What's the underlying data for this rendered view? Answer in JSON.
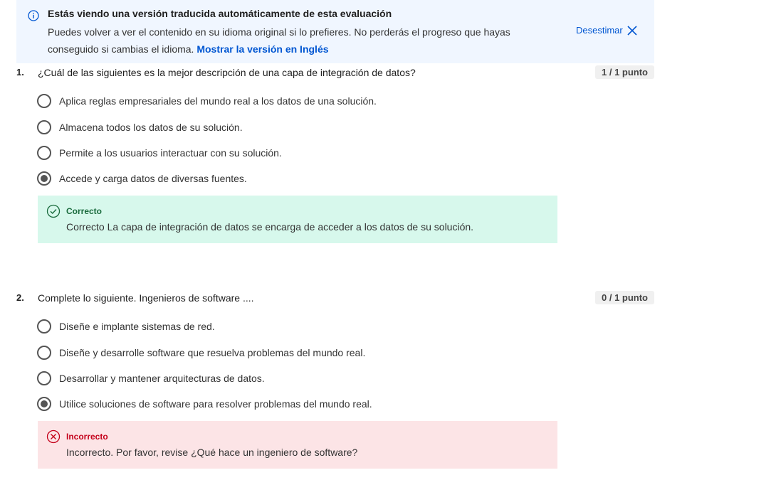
{
  "banner": {
    "icon": "info-icon",
    "title": "Estás viendo una versión traducida automáticamente de esta evaluación",
    "text": "Puedes volver a ver el contenido en su idioma original si lo prefieres. No perderás el progreso que hayas conseguido si cambias el idioma.",
    "link": "Mostrar la versión en Inglés",
    "dismiss": "Desestimar",
    "colors": {
      "background": "#f0f6ff",
      "link": "#0056d2"
    }
  },
  "questions": [
    {
      "number": "1.",
      "text": "¿Cuál de las siguientes es la mejor descripción de una capa de integración de datos?",
      "points": "1 / 1 punto",
      "options": [
        {
          "label": "Aplica reglas empresariales del mundo real a los datos de una solución.",
          "checked": false
        },
        {
          "label": "Almacena todos los datos de su solución.",
          "checked": false
        },
        {
          "label": "Permite a los usuarios interactuar con su solución.",
          "checked": false
        },
        {
          "label": "Accede y carga datos de diversas fuentes.",
          "checked": true
        }
      ],
      "feedback": {
        "status": "correct",
        "title": "Correcto",
        "text": "Correcto La capa de integración de datos se encarga de acceder a los datos de su solución.",
        "color": "#d7f8ec"
      }
    },
    {
      "number": "2.",
      "text": "Complete lo siguiente. Ingenieros de software ....",
      "points": "0 / 1 punto",
      "options": [
        {
          "label": "Diseñe e implante sistemas de red.",
          "checked": false
        },
        {
          "label": "Diseñe y desarrolle software que resuelva problemas del mundo real.",
          "checked": false
        },
        {
          "label": "Desarrollar y mantener arquitecturas de datos.",
          "checked": false
        },
        {
          "label": "Utilice soluciones de software para resolver problemas del mundo real.",
          "checked": true
        }
      ],
      "feedback": {
        "status": "incorrect",
        "title": "Incorrecto",
        "text": "Incorrecto. Por favor, revise ¿Qué hace un ingeniero de software?",
        "color": "#fce4e6"
      }
    }
  ]
}
